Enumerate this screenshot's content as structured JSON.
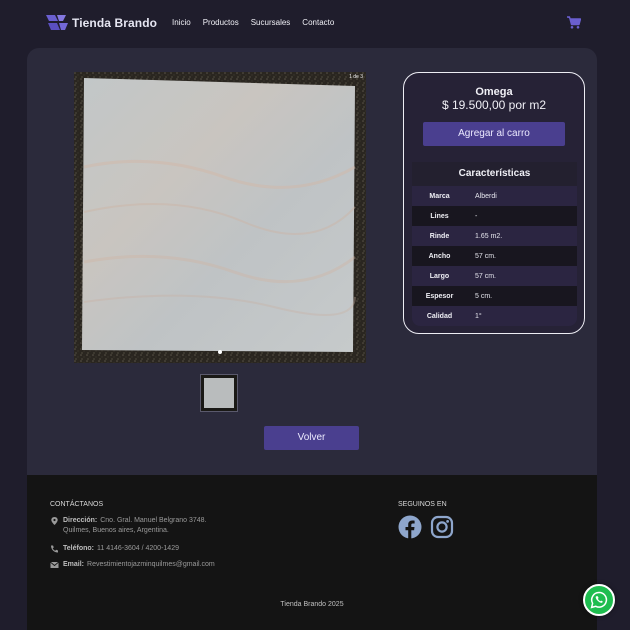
{
  "navbar": {
    "brand": "Tienda Brando",
    "links": [
      "Inicio",
      "Productos",
      "Sucursales",
      "Contacto"
    ]
  },
  "product": {
    "carousel_counter": "1 de 3",
    "name": "Omega",
    "price": "$ 19.500,00 por m2",
    "add_to_cart": "Agregar al carro",
    "specs_title": "Características",
    "specs": [
      {
        "key": "Marca",
        "value": "Alberdi"
      },
      {
        "key": "Lines",
        "value": "-"
      },
      {
        "key": "Rinde",
        "value": "1.65 m2."
      },
      {
        "key": "Ancho",
        "value": "57 cm."
      },
      {
        "key": "Largo",
        "value": "57 cm."
      },
      {
        "key": "Espesor",
        "value": "5 cm."
      },
      {
        "key": "Calidad",
        "value": "1°"
      }
    ],
    "back_button": "Volver"
  },
  "footer": {
    "contact_title": "CONTÁCTANOS",
    "address_label": "Dirección:",
    "address_line1": "Cno. Gral. Manuel Belgrano 3748.",
    "address_line2": "Quilmes, Buenos aires, Argentina.",
    "phone_label": "Teléfono:",
    "phone": "11 4146-3604 / 4200-1429",
    "email_label": "Email:",
    "email": "Revestimientojazminquilmes@gmail.com",
    "social_title": "SEGUINOS EN",
    "copyright": "Tienda Brando 2025"
  },
  "icons": {
    "cart": "cart-icon",
    "location": "map-pin-icon",
    "phone": "phone-icon",
    "email": "envelope-icon",
    "facebook": "facebook-icon",
    "instagram": "instagram-icon",
    "whatsapp": "whatsapp-icon"
  },
  "colors": {
    "accent": "#4a3f8f",
    "brand": "#6a5fd0",
    "whatsapp": "#1ebd4f"
  }
}
